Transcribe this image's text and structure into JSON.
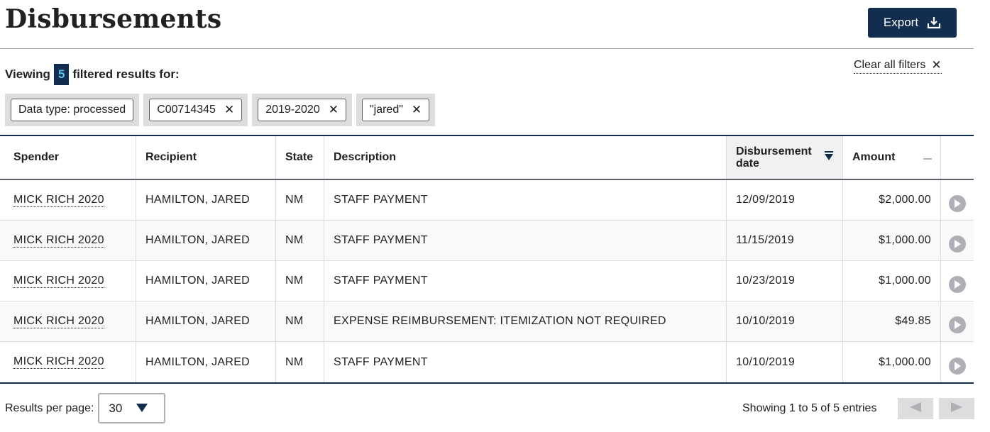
{
  "page": {
    "title": "Disbursements"
  },
  "toolbar": {
    "export_label": "Export"
  },
  "filters": {
    "viewing_label": "Viewing",
    "count": "5",
    "suffix": "filtered results for:",
    "clear_all": "Clear all filters",
    "tags": [
      {
        "label": "Data type: processed",
        "removable": false
      },
      {
        "label": "C00714345",
        "removable": true
      },
      {
        "label": "2019-2020",
        "removable": true
      },
      {
        "label": "\"jared\"",
        "removable": true
      }
    ],
    "remove_glyph": "✕"
  },
  "table": {
    "columns": [
      "Spender",
      "Recipient",
      "State",
      "Description",
      "Disbursement date",
      "Amount"
    ],
    "sorted_column": "Disbursement date",
    "rows": [
      {
        "spender": "MICK RICH 2020",
        "recipient": "HAMILTON, JARED",
        "state": "NM",
        "description": "STAFF PAYMENT",
        "date": "12/09/2019",
        "amount": "$2,000.00"
      },
      {
        "spender": "MICK RICH 2020",
        "recipient": "HAMILTON, JARED",
        "state": "NM",
        "description": "STAFF PAYMENT",
        "date": "11/15/2019",
        "amount": "$1,000.00"
      },
      {
        "spender": "MICK RICH 2020",
        "recipient": "HAMILTON, JARED",
        "state": "NM",
        "description": "STAFF PAYMENT",
        "date": "10/23/2019",
        "amount": "$1,000.00"
      },
      {
        "spender": "MICK RICH 2020",
        "recipient": "HAMILTON, JARED",
        "state": "NM",
        "description": "EXPENSE REIMBURSEMENT: ITEMIZATION NOT REQUIRED",
        "date": "10/10/2019",
        "amount": "$49.85"
      },
      {
        "spender": "MICK RICH 2020",
        "recipient": "HAMILTON, JARED",
        "state": "NM",
        "description": "STAFF PAYMENT",
        "date": "10/10/2019",
        "amount": "$1,000.00"
      }
    ]
  },
  "pagination": {
    "results_per_page_label": "Results per page:",
    "results_per_page_value": "30",
    "showing": "Showing 1 to 5 of 5 entries"
  },
  "icons": [
    "download-icon",
    "close-icon",
    "sort-descending-icon",
    "collapse-icon",
    "play-icon",
    "dropdown-arrow-icon",
    "prev-arrow-icon",
    "next-arrow-icon"
  ],
  "colors": {
    "primary": "#112e51",
    "badge_text": "#5ac0e8",
    "tag_bg": "#dddddd",
    "icon_gray": "#aeb0b5"
  }
}
